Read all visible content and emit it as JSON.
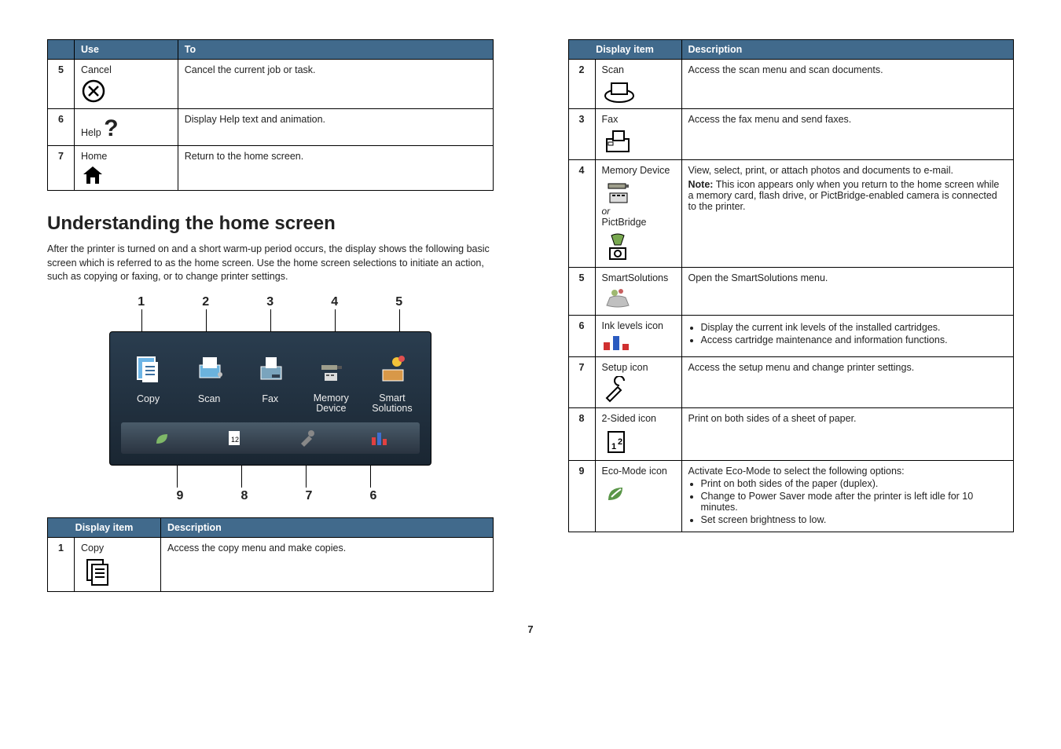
{
  "left_table_a": {
    "headers": {
      "c1": "Use",
      "c2": "To"
    },
    "r5": {
      "num": "5",
      "label": "Cancel",
      "desc": "Cancel the current job or task."
    },
    "r6": {
      "num": "6",
      "label": "Help",
      "desc": "Display Help text and animation."
    },
    "r7": {
      "num": "7",
      "label": "Home",
      "desc": "Return to the home screen."
    }
  },
  "heading": "Understanding the home screen",
  "intro": "After the printer is turned on and a short warm-up period occurs, the display shows the following basic screen which is referred to as the home screen. Use the home screen selections to initiate an action, such as copying or faxing, or to change printer settings.",
  "home_screen": {
    "top_labels": [
      "1",
      "2",
      "3",
      "4",
      "5"
    ],
    "tiles": [
      "Copy",
      "Scan",
      "Fax",
      "Memory Device",
      "Smart Solutions"
    ],
    "bottom_labels": [
      "9",
      "8",
      "7",
      "6"
    ]
  },
  "left_table_b": {
    "headers": {
      "c1": "Display item",
      "c2": "Description"
    },
    "r1": {
      "num": "1",
      "label": "Copy",
      "desc": "Access the copy menu and make copies."
    }
  },
  "right_table": {
    "headers": {
      "c1": "Display item",
      "c2": "Description"
    },
    "r2": {
      "num": "2",
      "label": "Scan",
      "desc": "Access the scan menu and scan documents."
    },
    "r3": {
      "num": "3",
      "label": "Fax",
      "desc": "Access the fax menu and send faxes."
    },
    "r4": {
      "num": "4",
      "label": "Memory Device",
      "or": "or",
      "label2": "PictBridge",
      "desc1": "View, select, print, or attach photos and documents to e-mail.",
      "note_label": "Note:",
      "note": " This icon appears only when you return to the home screen while a memory card, flash drive, or PictBridge-enabled camera is connected to the printer."
    },
    "r5": {
      "num": "5",
      "label": "SmartSolutions",
      "desc": "Open the SmartSolutions menu."
    },
    "r6": {
      "num": "6",
      "label": "Ink levels icon",
      "b1": "Display the current ink levels of the installed cartridges.",
      "b2": "Access cartridge maintenance and information functions."
    },
    "r7": {
      "num": "7",
      "label": "Setup icon",
      "desc": "Access the setup menu and change printer settings."
    },
    "r8": {
      "num": "8",
      "label": "2-Sided icon",
      "desc": "Print on both sides of a sheet of paper."
    },
    "r9": {
      "num": "9",
      "label": "Eco-Mode icon",
      "desc": "Activate Eco-Mode to select the following options:",
      "b1": "Print on both sides of the paper (duplex).",
      "b2": "Change to Power Saver mode after the printer is left idle for 10 minutes.",
      "b3": "Set screen brightness to low."
    }
  },
  "page_number": "7"
}
